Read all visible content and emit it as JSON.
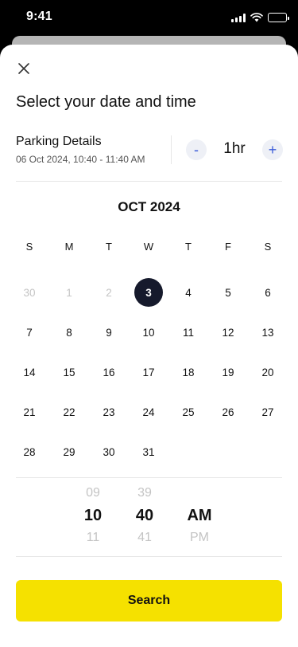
{
  "status_bar": {
    "time": "9:41"
  },
  "sheet": {
    "title": "Select your date and time",
    "parking": {
      "title": "Parking Details",
      "subtitle": "06 Oct 2024, 10:40 - 11:40 AM"
    },
    "duration": {
      "minus_label": "-",
      "value": "1hr",
      "plus_label": "+"
    },
    "calendar": {
      "month_label": "OCT 2024",
      "weekdays": [
        "S",
        "M",
        "T",
        "W",
        "T",
        "F",
        "S"
      ],
      "days": [
        "30",
        "1",
        "2",
        "3",
        "4",
        "5",
        "6",
        "7",
        "8",
        "9",
        "10",
        "11",
        "12",
        "13",
        "14",
        "15",
        "16",
        "17",
        "18",
        "19",
        "20",
        "21",
        "22",
        "23",
        "24",
        "25",
        "26",
        "27",
        "28",
        "29",
        "30",
        "31"
      ],
      "selected": "3"
    },
    "time_picker": {
      "hour": {
        "prev": "09",
        "current": "10",
        "next": "11"
      },
      "minute": {
        "prev": "39",
        "current": "40",
        "next": "41"
      },
      "period": {
        "prev": "",
        "current": "AM",
        "next": "PM"
      }
    },
    "search_label": "Search"
  },
  "colors": {
    "accent": "#f5e100",
    "selected_day": "#161a2c",
    "stepper_icon": "#3a5bd9",
    "muted_text": "#c4c4c4"
  },
  "icons": {
    "close": "close-icon",
    "signal": "cellular-signal-icon",
    "wifi": "wifi-icon",
    "battery": "battery-icon"
  }
}
